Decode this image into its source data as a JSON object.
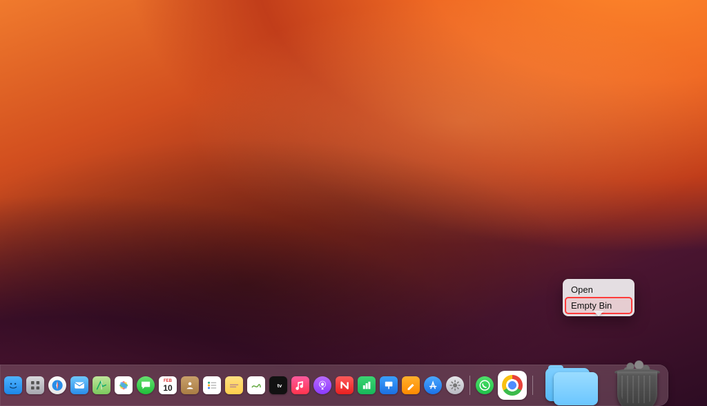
{
  "context_menu": {
    "open_label": "Open",
    "empty_bin_label": "Empty Bin"
  },
  "calendar": {
    "month": "FEB",
    "day": "10"
  },
  "dock": {
    "apps": {
      "finder": "Finder",
      "launchpad": "Launchpad",
      "safari": "Safari",
      "mail": "Mail",
      "maps": "Maps",
      "photos": "Photos",
      "messages": "Messages",
      "calendar": "Calendar",
      "contacts": "Contacts",
      "reminders": "Reminders",
      "notes": "Notes",
      "freeform": "Freeform",
      "tv": "TV",
      "music": "Music",
      "podcasts": "Podcasts",
      "news": "News",
      "numbers": "Numbers",
      "keynote": "Keynote",
      "pages": "Pages",
      "appstore": "App Store",
      "settings": "System Settings",
      "whatsapp": "WhatsApp",
      "chrome": "Google Chrome",
      "downloads": "Downloads",
      "trash": "Bin"
    }
  }
}
